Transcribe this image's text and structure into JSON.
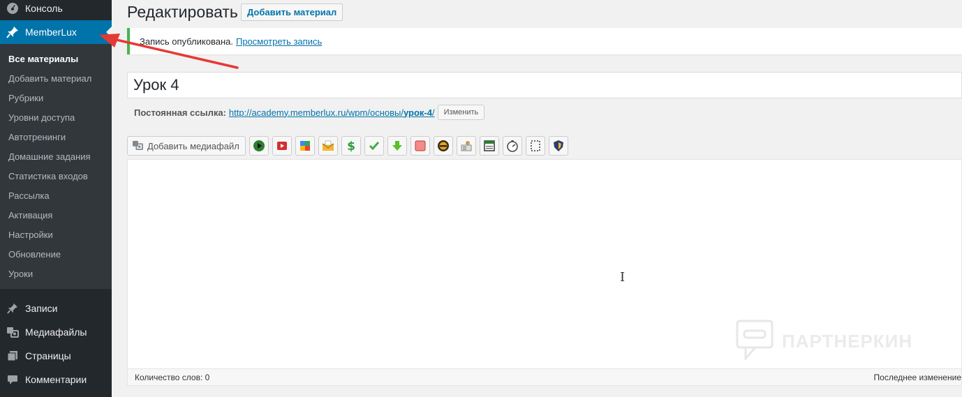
{
  "sidebar": {
    "top_items": {
      "console": "Консоль",
      "memberlux": "MemberLux",
      "posts": "Записи",
      "media": "Медиафайлы",
      "pages": "Страницы",
      "comments": "Комментарии"
    },
    "submenu": [
      "Все материалы",
      "Добавить материал",
      "Рубрики",
      "Уровни доступа",
      "Автотренинги",
      "Домашние задания",
      "Статистика входов",
      "Рассылка",
      "Активация",
      "Настройки",
      "Обновление",
      "Уроки"
    ]
  },
  "header": {
    "title": "Редактировать",
    "add_button": "Добавить материал"
  },
  "notice": {
    "text": "Запись опубликована.",
    "link": "Просмотреть запись"
  },
  "post": {
    "title": "Урок 4",
    "permalink_label": "Постоянная ссылка:",
    "permalink_base": "http://academy.memberlux.ru/wpm/основы/",
    "permalink_slug": "урок-4",
    "permalink_end": "/",
    "permalink_edit": "Изменить"
  },
  "toolbar": {
    "add_media": "Добавить медиафайл",
    "icons": [
      "play-icon",
      "youtube-icon",
      "google-icon",
      "envelope-icon",
      "dollar-icon",
      "check-icon",
      "download-icon",
      "stop-icon",
      "badge-icon",
      "user-card-icon",
      "window-icon",
      "timer-icon",
      "dotted-box-icon",
      "shield-icon"
    ]
  },
  "editor": {
    "word_count": "Количество слов: 0",
    "last_edit": "Последнее изменение"
  },
  "watermark": "ПАРТНЕРКИН",
  "colors": {
    "sidebar_bg": "#23282d",
    "submenu_bg": "#32373c",
    "accent": "#0073aa",
    "notice_green": "#46b450",
    "annotation_red": "#e53935"
  }
}
